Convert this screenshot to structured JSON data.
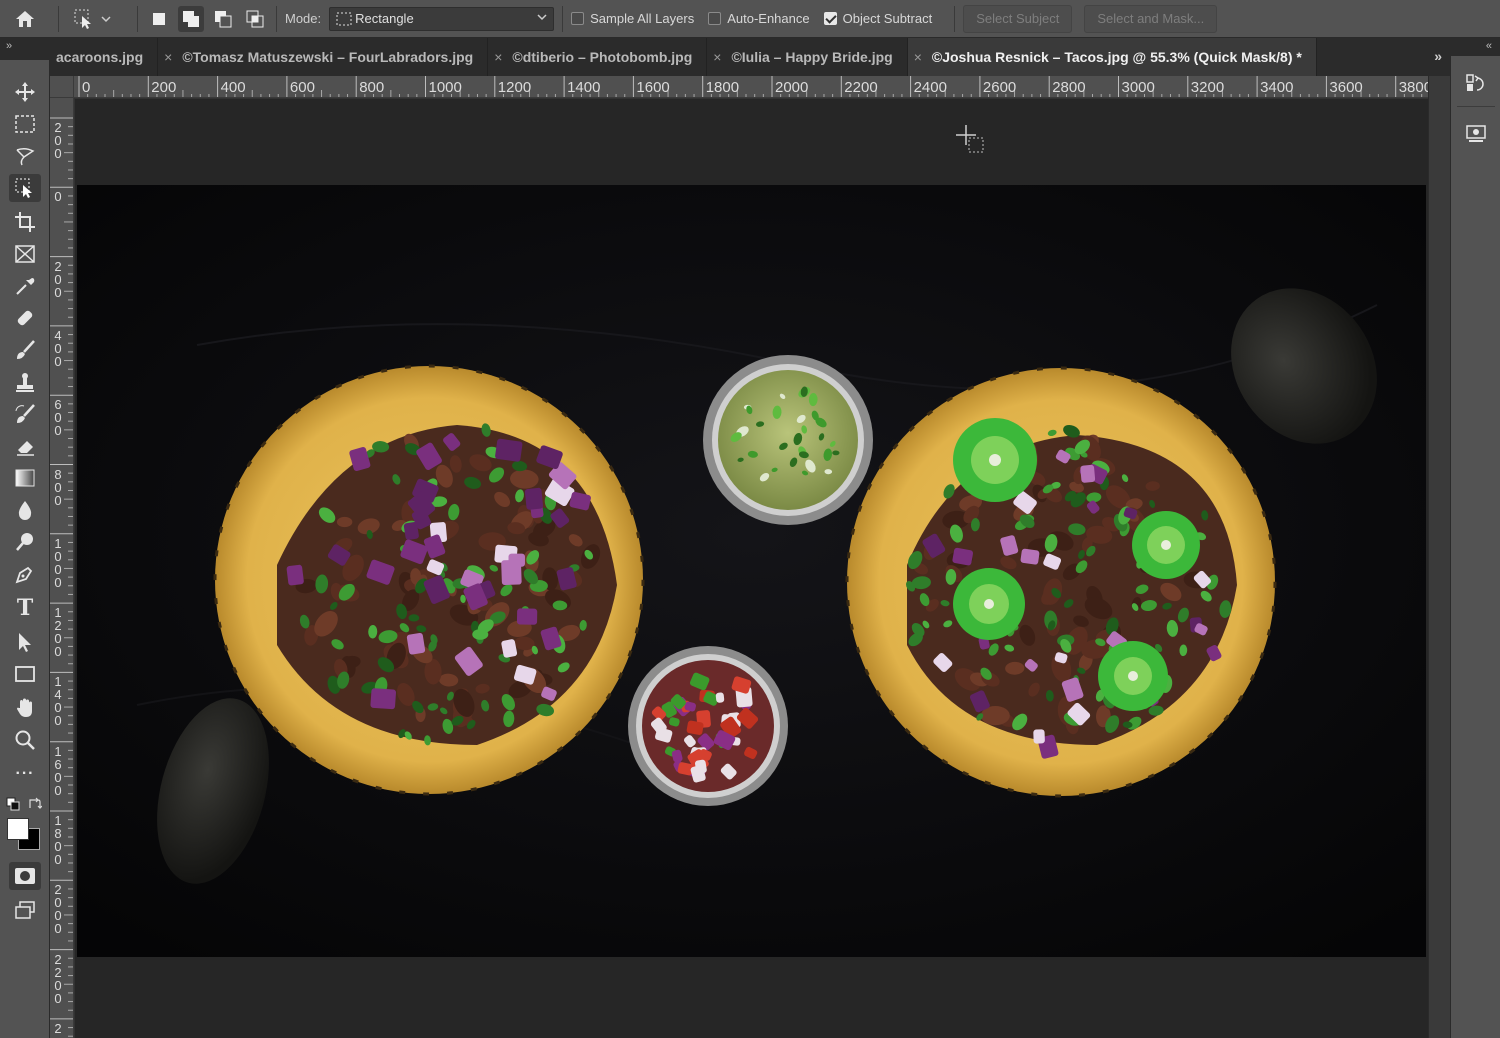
{
  "options_bar": {
    "mode_label": "Mode:",
    "mode_value": "Rectangle",
    "checkboxes": [
      {
        "label": "Sample All Layers",
        "checked": false
      },
      {
        "label": "Auto-Enhance",
        "checked": false
      },
      {
        "label": "Object Subtract",
        "checked": true
      }
    ],
    "select_subject": "Select Subject",
    "select_and_mask": "Select and Mask..."
  },
  "panel_collapse": {
    "left": "»",
    "right": "«"
  },
  "tabs": [
    {
      "label": "acaroons.jpg",
      "active": false
    },
    {
      "label": "©Tomasz Matuszewski – FourLabradors.jpg",
      "active": false
    },
    {
      "label": "©dtiberio – Photobomb.jpg",
      "active": false
    },
    {
      "label": "©Iulia – Happy Bride.jpg",
      "active": false
    },
    {
      "label": "©Joshua Resnick – Tacos.jpg @ 55.3% (Quick Mask/8) *",
      "active": true
    }
  ],
  "tabs_overflow": "»",
  "tab_close": "×",
  "ruler": {
    "horizontal": [
      "0",
      "200",
      "400",
      "600",
      "800",
      "1000",
      "1200",
      "1400",
      "1600",
      "1800",
      "2000",
      "2200",
      "2400",
      "2600",
      "2800",
      "3000",
      "3200",
      "3400",
      "3600",
      "3800"
    ],
    "vertical": [
      "200",
      "0",
      "200",
      "400",
      "600",
      "800",
      "1000",
      "1200",
      "1400",
      "1600",
      "1800",
      "2000",
      "2200",
      "2"
    ]
  },
  "tools": [
    {
      "name": "move-tool-icon"
    },
    {
      "name": "marquee-tool-icon"
    },
    {
      "name": "lasso-tool-icon"
    },
    {
      "name": "object-selection-tool-icon",
      "active": true
    },
    {
      "name": "crop-tool-icon"
    },
    {
      "name": "frame-tool-icon"
    },
    {
      "name": "eyedropper-tool-icon"
    },
    {
      "name": "healing-brush-tool-icon"
    },
    {
      "name": "brush-tool-icon"
    },
    {
      "name": "clone-stamp-tool-icon"
    },
    {
      "name": "history-brush-tool-icon"
    },
    {
      "name": "eraser-tool-icon"
    },
    {
      "name": "gradient-tool-icon"
    },
    {
      "name": "blur-tool-icon"
    },
    {
      "name": "dodge-tool-icon"
    },
    {
      "name": "pen-tool-icon"
    },
    {
      "name": "type-tool-icon"
    },
    {
      "name": "path-selection-tool-icon"
    },
    {
      "name": "rectangle-tool-icon"
    },
    {
      "name": "hand-tool-icon"
    },
    {
      "name": "zoom-tool-icon"
    },
    {
      "name": "more-tools-icon"
    }
  ],
  "type_tool_glyph": "T",
  "more_tools_glyph": "···",
  "colors": {
    "foreground": "#ffffff",
    "background": "#000000",
    "ui_bg": "#535353",
    "canvas_bg": "#262626",
    "tortilla": "#e2b64e",
    "jalapeno": "#3cb83a",
    "onion": "#7a2f7e"
  }
}
